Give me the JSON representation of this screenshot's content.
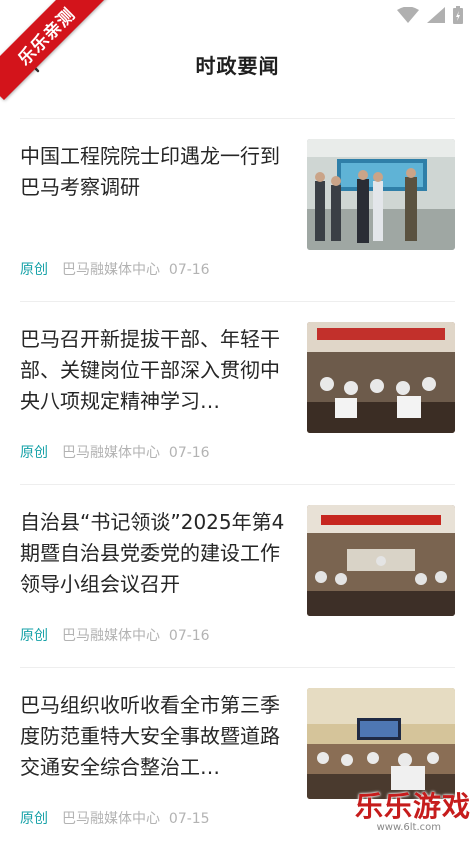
{
  "header": {
    "title": "时政要闻",
    "ribbon_text": "乐乐亲测"
  },
  "news": [
    {
      "title": "中国工程院院士印遇龙一行到巴马考察调研",
      "tag": "原创",
      "source": "巴马融媒体中心",
      "date": "07-16",
      "image": "officials-visiting-screen-photo"
    },
    {
      "title": "巴马召开新提拔干部、年轻干部、关键岗位干部深入贯彻中央八项规定精神学习…",
      "tag": "原创",
      "source": "巴马融媒体中心",
      "date": "07-16",
      "image": "conference-hall-photo"
    },
    {
      "title": "自治县“书记领谈”2025年第4期暨自治县党委党的建设工作领导小组会议召开",
      "tag": "原创",
      "source": "巴马融媒体中心",
      "date": "07-16",
      "image": "meeting-room-red-banner-photo"
    },
    {
      "title": "巴马组织收听收看全市第三季度防范重特大安全事故暨道路交通安全综合整治工…",
      "tag": "原创",
      "source": "巴马融媒体中心",
      "date": "07-15",
      "image": "video-conference-photo"
    }
  ],
  "watermark": {
    "text": "乐乐游戏",
    "url": "www.6lt.com"
  },
  "colors": {
    "tag": "#17a2a8",
    "meta": "#b3b3b3",
    "ribbon": "#d3141b"
  }
}
